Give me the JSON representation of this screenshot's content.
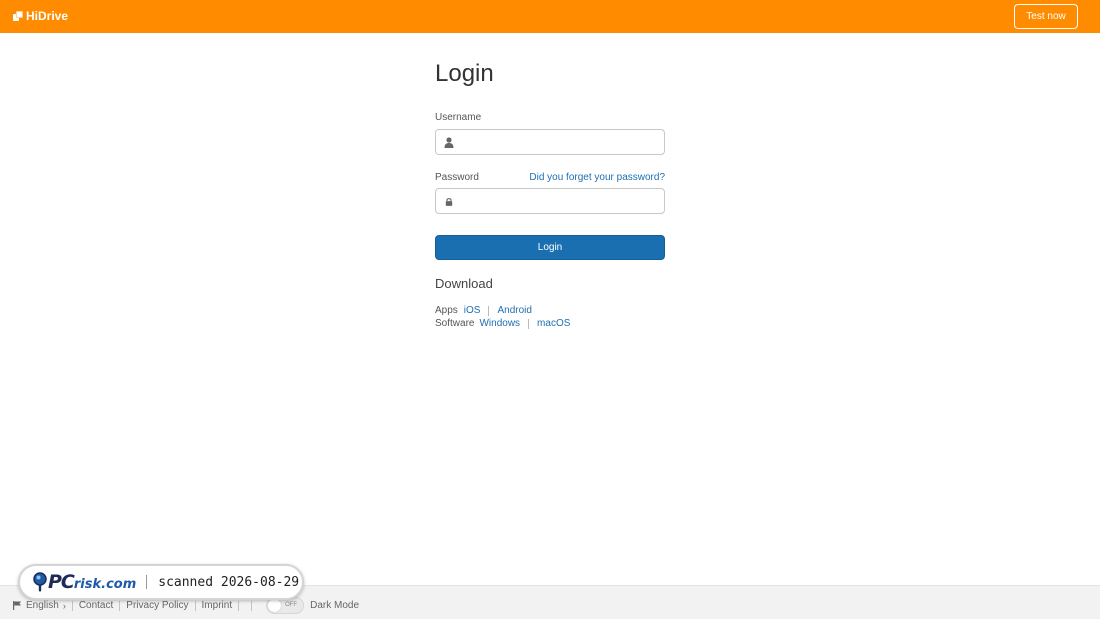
{
  "header": {
    "brand": "HiDrive",
    "test_button": "Test now",
    "accent_color": "#ff8c00"
  },
  "login": {
    "title": "Login",
    "username_label": "Username",
    "username_value": "",
    "username_icon": "user-icon",
    "password_label": "Password",
    "password_value": "",
    "password_icon": "lock-icon",
    "forgot_link": "Did you forget your password?",
    "submit_label": "Login",
    "button_color": "#1a6fb1"
  },
  "download": {
    "title": "Download",
    "apps_label": "Apps",
    "apps_links": [
      "iOS",
      "Android"
    ],
    "software_label": "Software",
    "software_links": [
      "Windows",
      "macOS"
    ]
  },
  "footer": {
    "language": "English",
    "language_icon": "flag-icon",
    "links": [
      "Contact",
      "Privacy Policy",
      "Imprint"
    ],
    "dark_mode_state": "OFF",
    "dark_mode_label": "Dark Mode"
  },
  "watermark": {
    "brand_pc": "PC",
    "brand_risk": "risk.com",
    "text": "scanned 2026-08-29"
  }
}
